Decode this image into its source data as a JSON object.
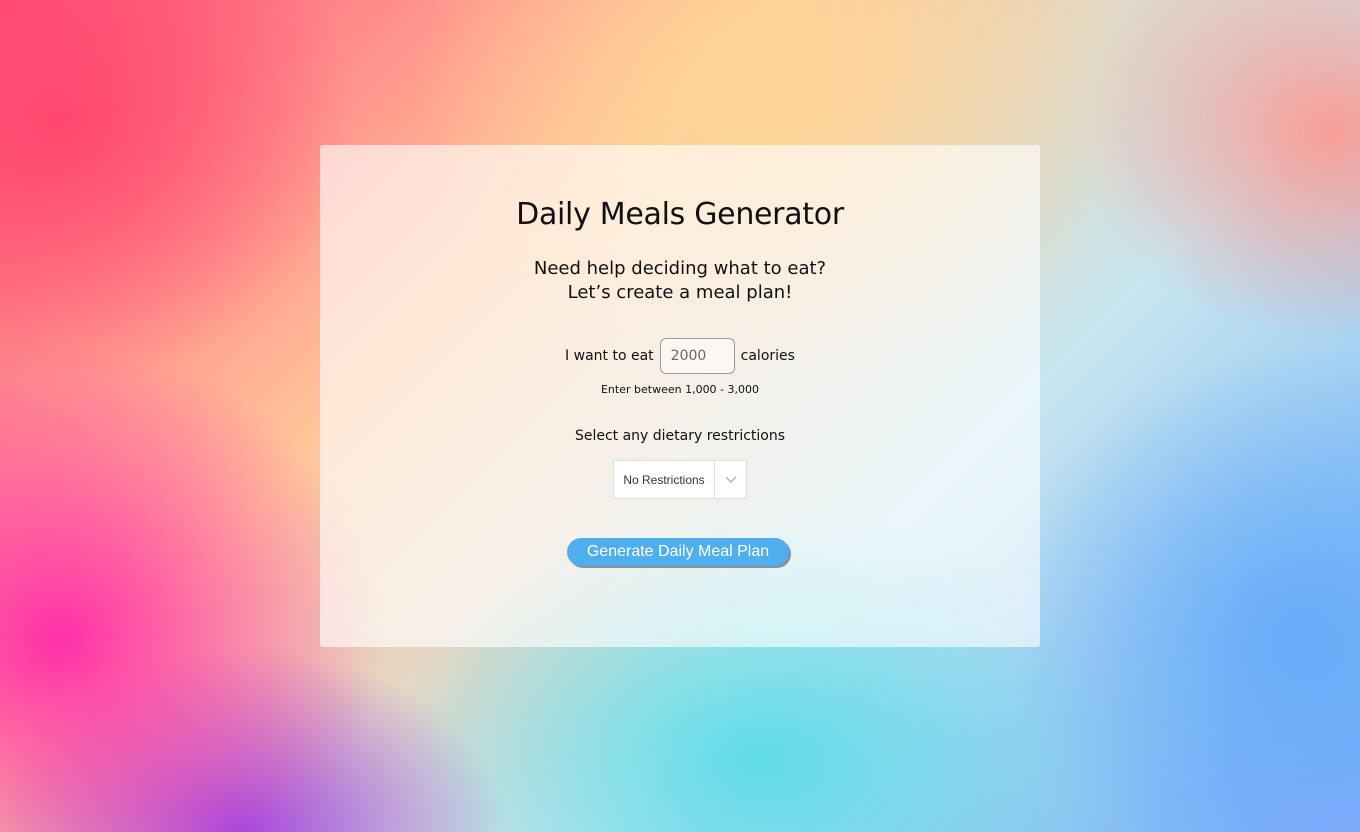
{
  "app": {
    "title": "Daily Meals Generator",
    "subtitle_line1": "Need help deciding what to eat?",
    "subtitle_line2": "Let’s create a meal plan!"
  },
  "calories": {
    "prefix_label": "I want to eat",
    "value": "2000",
    "suffix_label": "calories",
    "hint": "Enter between 1,000 - 3,000"
  },
  "diet": {
    "label": "Select any dietary restrictions",
    "selected": "No Restrictions",
    "icon": "chevron-down-icon"
  },
  "actions": {
    "generate_label": "Generate Daily Meal Plan"
  },
  "colors": {
    "button": "#4faeee",
    "card": "rgba(255,255,255,0.62)"
  }
}
